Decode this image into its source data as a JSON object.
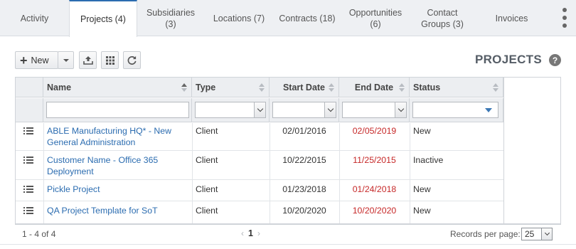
{
  "tabs": [
    {
      "label": "Activity"
    },
    {
      "label": "Projects (4)"
    },
    {
      "label": "Subsidiaries\n(3)"
    },
    {
      "label": "Locations (7)"
    },
    {
      "label": "Contracts (18)"
    },
    {
      "label": "Opportunities\n(6)"
    },
    {
      "label": "Contact\nGroups (3)"
    },
    {
      "label": "Invoices"
    }
  ],
  "toolbar": {
    "new_label": "New",
    "new_icon": "plus-icon",
    "export_icon": "export-icon",
    "columns_icon": "grid-icon",
    "refresh_icon": "refresh-icon"
  },
  "page": {
    "title": "PROJECTS",
    "help_glyph": "?"
  },
  "grid": {
    "columns": [
      "Name",
      "Type",
      "Start Date",
      "End Date",
      "Status"
    ],
    "rows": [
      {
        "name": "ABLE Manufacturing HQ* - New General Administration",
        "type": "Client",
        "start": "02/01/2016",
        "end": "02/05/2019",
        "status": "New"
      },
      {
        "name": "Customer Name - Office 365 Deployment",
        "type": "Client",
        "start": "10/22/2015",
        "end": "11/25/2015",
        "status": "Inactive"
      },
      {
        "name": "Pickle Project",
        "type": "Client",
        "start": "01/23/2018",
        "end": "01/24/2018",
        "status": "New"
      },
      {
        "name": "QA Project Template for SoT",
        "type": "Client",
        "start": "10/20/2020",
        "end": "10/20/2020",
        "status": "New"
      }
    ]
  },
  "footer": {
    "count": "1 - 4 of 4",
    "prev": "‹",
    "page": "1",
    "next": "›",
    "records_label": "Records per page:",
    "records_value": "25"
  },
  "colors": {
    "link": "#2b6cb0",
    "end_date": "#c62828",
    "active_tab_border": "#2b6cb0"
  }
}
